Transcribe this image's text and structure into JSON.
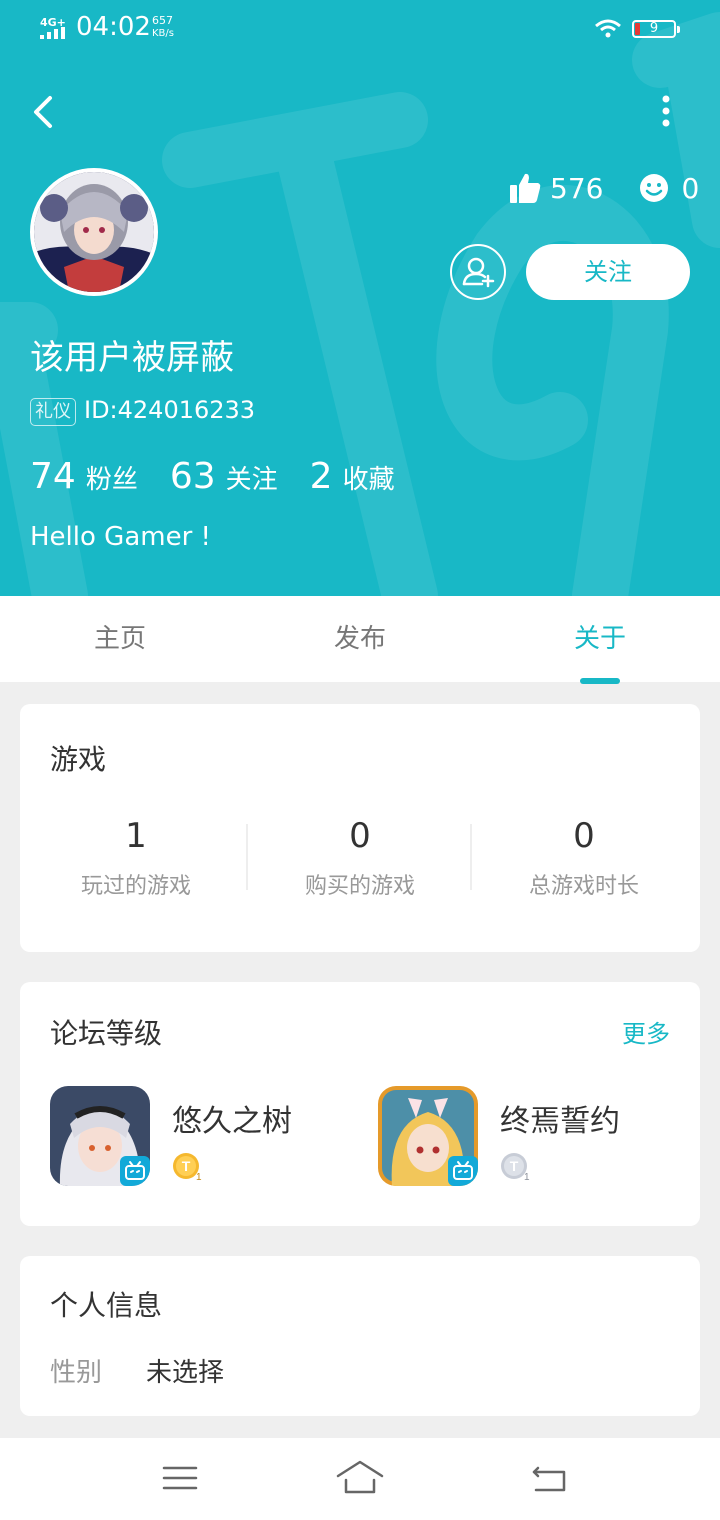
{
  "status": {
    "network": "4G+",
    "time": "04:02",
    "speed_value": "657",
    "speed_unit": "KB/s",
    "battery": "9"
  },
  "header": {
    "likes": "576",
    "smiles": "0",
    "follow_label": "关注",
    "username": "该用户被屏蔽",
    "badge": "礼仪",
    "user_id": "ID:424016233",
    "counts": [
      {
        "num": "74",
        "label": "粉丝"
      },
      {
        "num": "63",
        "label": "关注"
      },
      {
        "num": "2",
        "label": "收藏"
      }
    ],
    "bio": "Hello Gamer !",
    "colors": {
      "accent": "#18b8c6",
      "gold_badge": "#f5b82e",
      "silver_badge": "#c7ccd6"
    }
  },
  "tabs": [
    {
      "label": "主页"
    },
    {
      "label": "发布"
    },
    {
      "label": "关于"
    }
  ],
  "games_card": {
    "title": "游戏",
    "stats": [
      {
        "value": "1",
        "label": "玩过的游戏"
      },
      {
        "value": "0",
        "label": "购买的游戏"
      },
      {
        "value": "0",
        "label": "总游戏时长"
      }
    ]
  },
  "forum_card": {
    "title": "论坛等级",
    "more": "更多",
    "items": [
      {
        "name": "悠久之树",
        "level_badge": "T1",
        "badge_color": "gold"
      },
      {
        "name": "终焉誓约",
        "level_badge": "T1",
        "badge_color": "silver"
      }
    ]
  },
  "info_card": {
    "title": "个人信息",
    "gender_label": "性别",
    "gender_value": "未选择"
  },
  "icons": [
    "back-arrow-icon",
    "more-vertical-icon",
    "thumbs-up-icon",
    "smile-icon",
    "add-friend-icon",
    "menu-icon",
    "home-icon",
    "return-icon",
    "bilibili-icon"
  ]
}
